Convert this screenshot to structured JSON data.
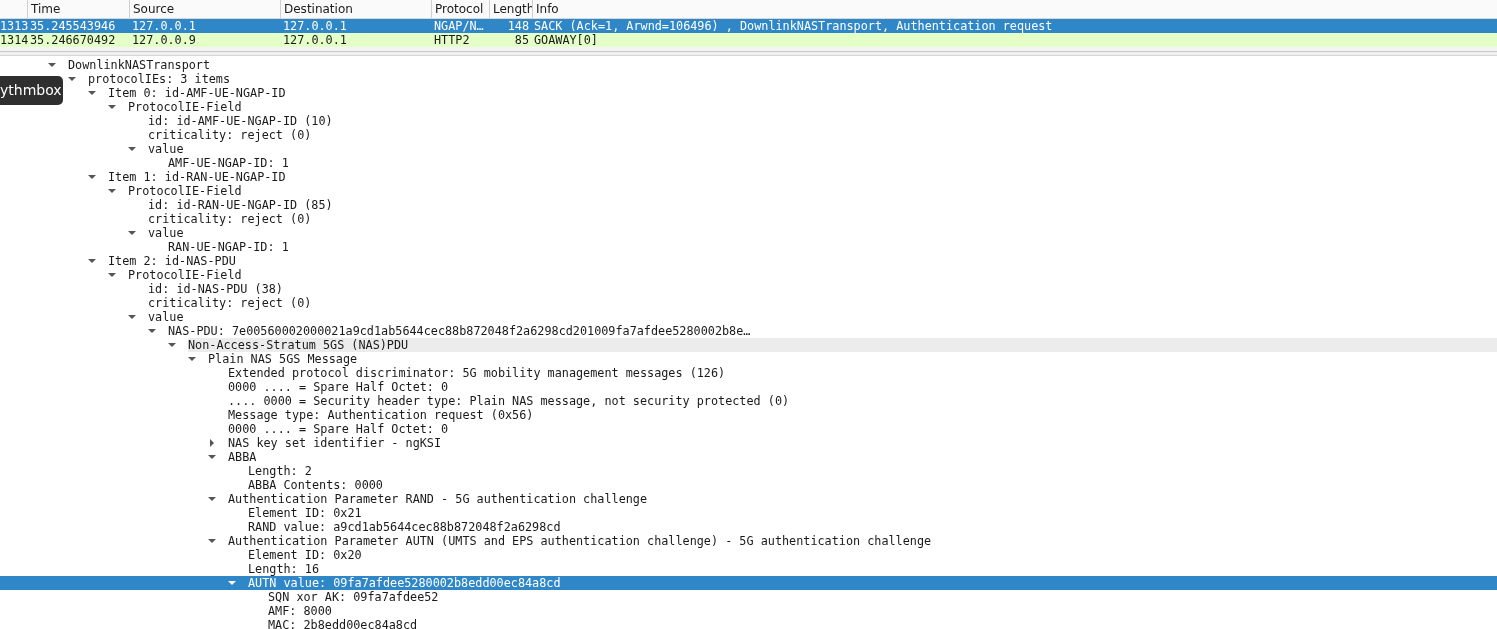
{
  "packet_list": {
    "columns": [
      "Time",
      "Source",
      "Destination",
      "Protocol",
      "Length",
      "Info"
    ],
    "rows": [
      {
        "no": "1313",
        "time": "35.245543946",
        "source": "127.0.0.1",
        "destination": "127.0.0.1",
        "protocol": "NGAP/N…",
        "length": "148",
        "info": "SACK (Ack=1, Arwnd=106496) , DownlinkNASTransport, Authentication request",
        "selected": true
      },
      {
        "no": "1314",
        "time": "35.246670492",
        "source": "127.0.0.9",
        "destination": "127.0.0.1",
        "protocol": "HTTP2",
        "length": "85",
        "info": "GOAWAY[0]",
        "selected": false
      }
    ]
  },
  "tooltip": {
    "text": "ythmbox"
  },
  "details_tree": [
    {
      "label": "DownlinkNASTransport",
      "expanded": true,
      "selected": false,
      "hovered": false,
      "children": [
        {
          "label": "protocolIEs: 3 items",
          "expanded": true,
          "selected": false,
          "hovered": false,
          "children": [
            {
              "label": "Item 0: id-AMF-UE-NGAP-ID",
              "expanded": true,
              "selected": false,
              "hovered": false,
              "children": [
                {
                  "label": "ProtocolIE-Field",
                  "expanded": true,
                  "selected": false,
                  "hovered": false,
                  "children": [
                    {
                      "label": "id: id-AMF-UE-NGAP-ID (10)",
                      "selected": false,
                      "hovered": false
                    },
                    {
                      "label": "criticality: reject (0)",
                      "selected": false,
                      "hovered": false
                    },
                    {
                      "label": "value",
                      "expanded": true,
                      "selected": false,
                      "hovered": false,
                      "children": [
                        {
                          "label": "AMF-UE-NGAP-ID: 1",
                          "selected": false,
                          "hovered": false
                        }
                      ]
                    }
                  ]
                }
              ]
            },
            {
              "label": "Item 1: id-RAN-UE-NGAP-ID",
              "expanded": true,
              "selected": false,
              "hovered": false,
              "children": [
                {
                  "label": "ProtocolIE-Field",
                  "expanded": true,
                  "selected": false,
                  "hovered": false,
                  "children": [
                    {
                      "label": "id: id-RAN-UE-NGAP-ID (85)",
                      "selected": false,
                      "hovered": false
                    },
                    {
                      "label": "criticality: reject (0)",
                      "selected": false,
                      "hovered": false
                    },
                    {
                      "label": "value",
                      "expanded": true,
                      "selected": false,
                      "hovered": false,
                      "children": [
                        {
                          "label": "RAN-UE-NGAP-ID: 1",
                          "selected": false,
                          "hovered": false
                        }
                      ]
                    }
                  ]
                }
              ]
            },
            {
              "label": "Item 2: id-NAS-PDU",
              "expanded": true,
              "selected": false,
              "hovered": false,
              "children": [
                {
                  "label": "ProtocolIE-Field",
                  "expanded": true,
                  "selected": false,
                  "hovered": false,
                  "children": [
                    {
                      "label": "id: id-NAS-PDU (38)",
                      "selected": false,
                      "hovered": false
                    },
                    {
                      "label": "criticality: reject (0)",
                      "selected": false,
                      "hovered": false
                    },
                    {
                      "label": "value",
                      "expanded": true,
                      "selected": false,
                      "hovered": false,
                      "children": [
                        {
                          "label": "NAS-PDU: 7e00560002000021a9cd1ab5644cec88b872048f2a6298cd201009fa7afdee5280002b8e…",
                          "expanded": true,
                          "selected": false,
                          "hovered": false,
                          "children": [
                            {
                              "label": "Non-Access-Stratum 5GS (NAS)PDU",
                              "expanded": true,
                              "selected": false,
                              "hovered": true,
                              "children": [
                                {
                                  "label": "Plain NAS 5GS Message",
                                  "expanded": true,
                                  "selected": false,
                                  "hovered": false,
                                  "children": [
                                    {
                                      "label": "Extended protocol discriminator: 5G mobility management messages (126)",
                                      "selected": false,
                                      "hovered": false
                                    },
                                    {
                                      "label": "0000 .... = Spare Half Octet: 0",
                                      "selected": false,
                                      "hovered": false
                                    },
                                    {
                                      "label": ".... 0000 = Security header type: Plain NAS message, not security protected (0)",
                                      "selected": false,
                                      "hovered": false
                                    },
                                    {
                                      "label": "Message type: Authentication request (0x56)",
                                      "selected": false,
                                      "hovered": false
                                    },
                                    {
                                      "label": "0000 .... = Spare Half Octet: 0",
                                      "selected": false,
                                      "hovered": false
                                    },
                                    {
                                      "label": "NAS key set identifier - ngKSI",
                                      "expanded": false,
                                      "selected": false,
                                      "hovered": false
                                    },
                                    {
                                      "label": "ABBA",
                                      "expanded": true,
                                      "selected": false,
                                      "hovered": false,
                                      "children": [
                                        {
                                          "label": "Length: 2",
                                          "selected": false,
                                          "hovered": false
                                        },
                                        {
                                          "label": "ABBA Contents: 0000",
                                          "selected": false,
                                          "hovered": false
                                        }
                                      ]
                                    },
                                    {
                                      "label": "Authentication Parameter RAND - 5G authentication challenge",
                                      "expanded": true,
                                      "selected": false,
                                      "hovered": false,
                                      "children": [
                                        {
                                          "label": "Element ID: 0x21",
                                          "selected": false,
                                          "hovered": false
                                        },
                                        {
                                          "label": "RAND value: a9cd1ab5644cec88b872048f2a6298cd",
                                          "selected": false,
                                          "hovered": false
                                        }
                                      ]
                                    },
                                    {
                                      "label": "Authentication Parameter AUTN (UMTS and EPS authentication challenge) - 5G authentication challenge",
                                      "expanded": true,
                                      "selected": false,
                                      "hovered": false,
                                      "children": [
                                        {
                                          "label": "Element ID: 0x20",
                                          "selected": false,
                                          "hovered": false
                                        },
                                        {
                                          "label": "Length: 16",
                                          "selected": false,
                                          "hovered": false
                                        },
                                        {
                                          "label": "AUTN value: 09fa7afdee5280002b8edd00ec84a8cd",
                                          "expanded": true,
                                          "selected": true,
                                          "hovered": false,
                                          "children": [
                                            {
                                              "label": "SQN xor AK: 09fa7afdee52",
                                              "selected": false,
                                              "hovered": false
                                            },
                                            {
                                              "label": "AMF: 8000",
                                              "selected": false,
                                              "hovered": false
                                            },
                                            {
                                              "label": "MAC: 2b8edd00ec84a8cd",
                                              "selected": false,
                                              "hovered": false
                                            }
                                          ]
                                        }
                                      ]
                                    }
                                  ]
                                }
                              ]
                            }
                          ]
                        }
                      ]
                    }
                  ]
                }
              ]
            }
          ]
        }
      ]
    }
  ]
}
